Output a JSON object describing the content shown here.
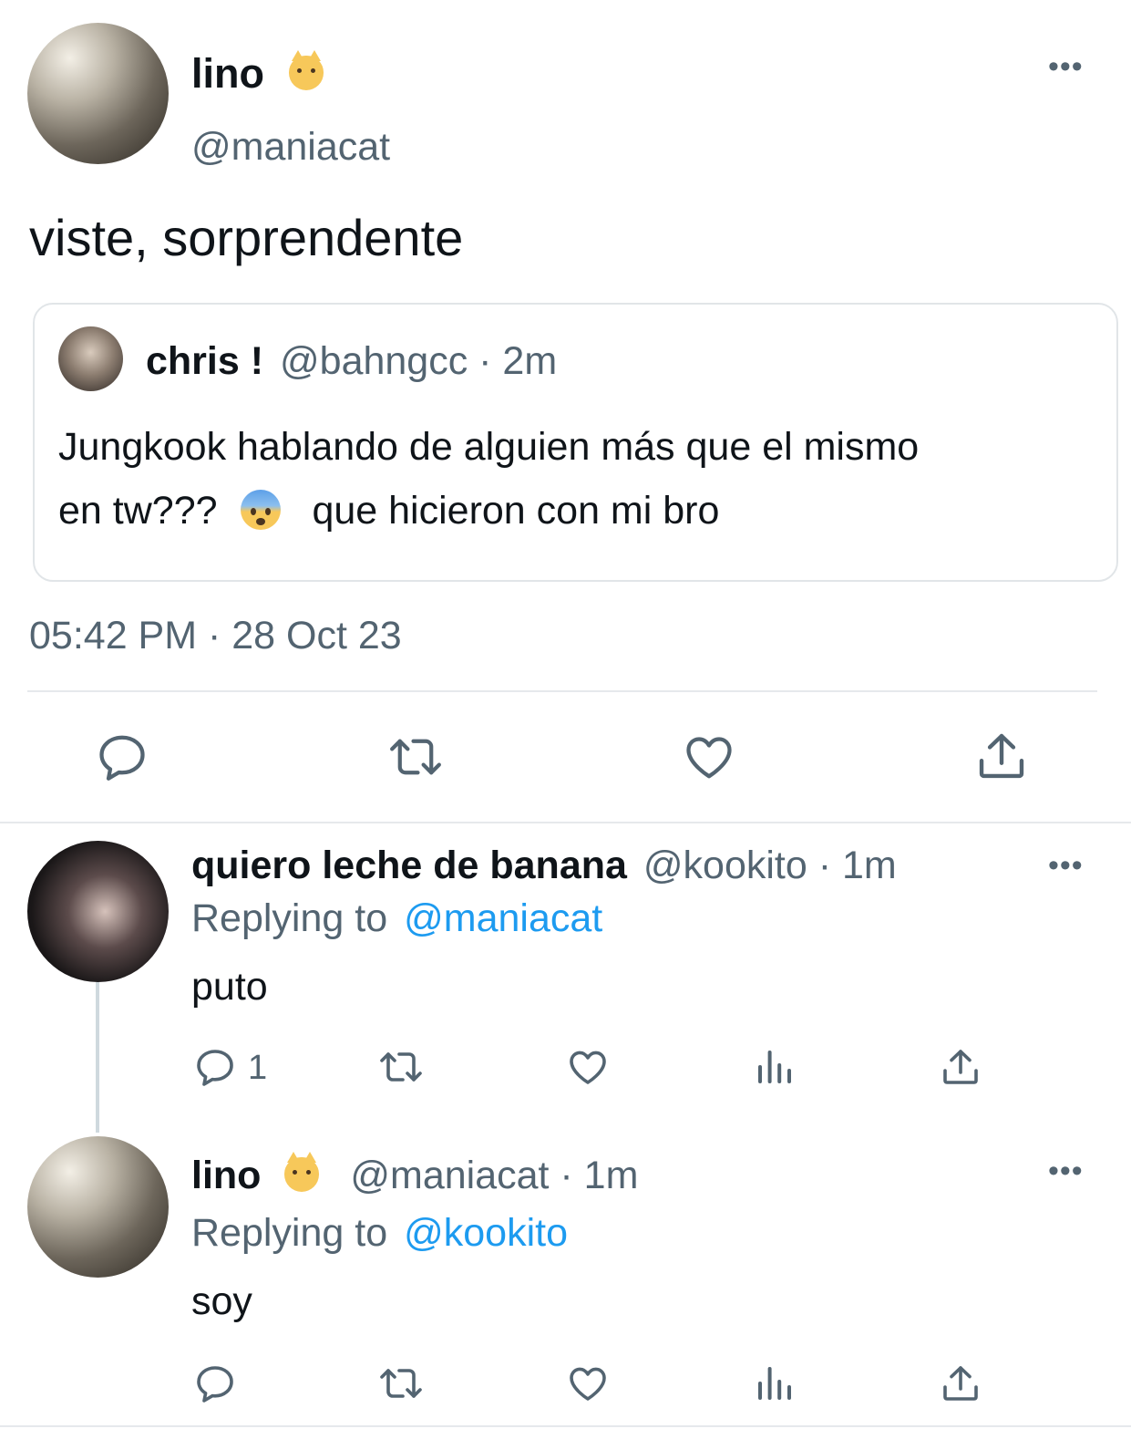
{
  "main_tweet": {
    "display_name": "lino",
    "handle": "@maniacat",
    "text": "viste, sorprendente",
    "timestamp": "05:42 PM · 28 Oct 23",
    "emoji_icon": "cat-face-emoji"
  },
  "quoted_tweet": {
    "display_name": "chris !",
    "handle_time": "@bahngcc · 2m",
    "text_line1": "Jungkook hablando de alguien más que el mismo",
    "text_line2_a": "en tw???",
    "text_line2_b": "que hicieron con mi bro",
    "emoji_icon": "fearful-face-emoji"
  },
  "reply_1": {
    "display_name": "quiero leche de banana",
    "handle_time": "@kookito · 1m",
    "replying_prefix": "Replying to",
    "replying_handle": "@maniacat",
    "text": "puto",
    "reply_count": "1"
  },
  "reply_2": {
    "display_name": "lino",
    "handle_time": "@maniacat · 1m",
    "replying_prefix": "Replying to",
    "replying_handle": "@kookito",
    "text": "soy"
  },
  "colors": {
    "link": "#1d9bf0",
    "secondary_text": "#536471",
    "divider": "#e6e9ec"
  }
}
